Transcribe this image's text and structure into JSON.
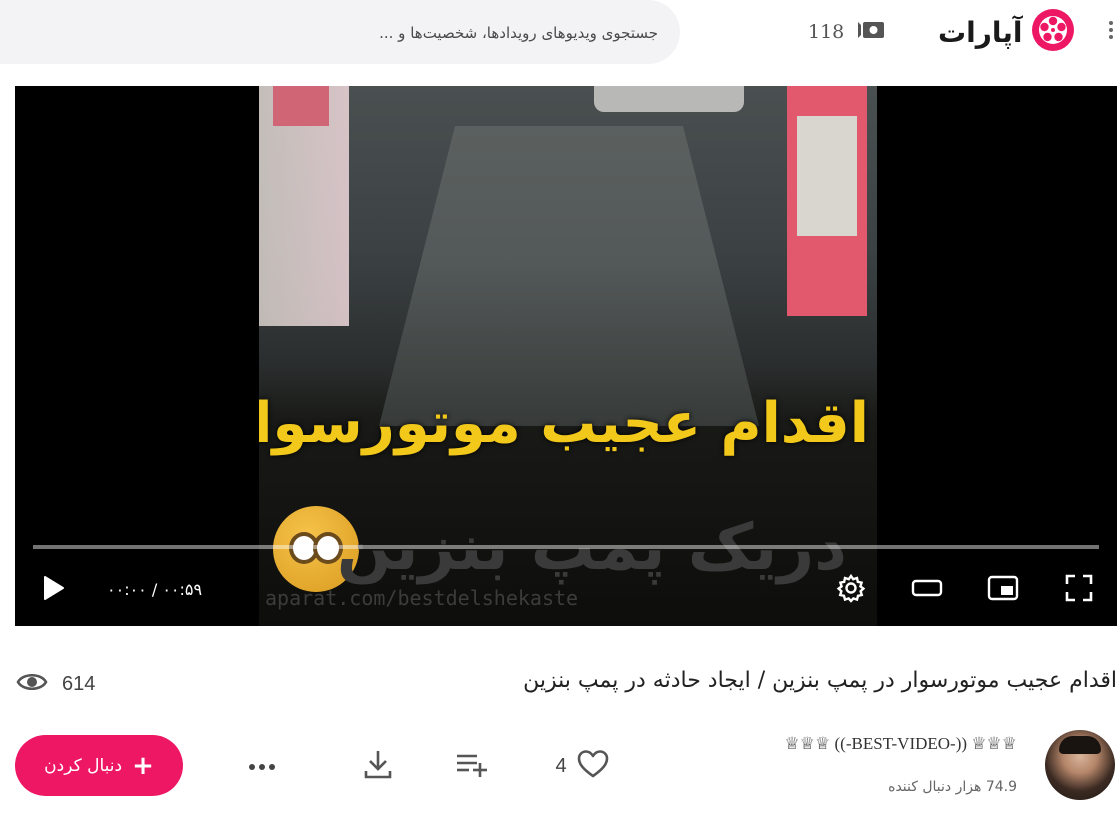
{
  "header": {
    "search_placeholder": "جستجوی ویدیوهای رویدادها، شخصیت‌ها و ...",
    "live_count": "118",
    "logo_text": "آپارات",
    "brand_color": "#ee1764"
  },
  "player": {
    "overlay_title": "اقدام عجیب موتورسوار",
    "overlay_subtitle": "دریک پمپ بنزین",
    "watermark": "aparat.com/bestdelshekaste",
    "time_display": "۰۰:۰۰ / ۰۰:۵۹",
    "progress": 0,
    "icons": {
      "play": "play-icon",
      "settings": "gear-icon",
      "theater": "theater-mode-icon",
      "pip": "picture-in-picture-icon",
      "fullscreen": "fullscreen-icon"
    }
  },
  "video": {
    "title": "اقدام عجیب موتورسوار در پمپ بنزین / ایجاد حادثه در پمپ بنزین",
    "views": "614"
  },
  "actions": {
    "follow_label": "دنبال کردن",
    "like_count": "4"
  },
  "channel": {
    "name": "♕♕♕ ((-BEST-VIDEO-)) ♕♕♕",
    "followers": "74.9 هزار دنبال کننده"
  }
}
